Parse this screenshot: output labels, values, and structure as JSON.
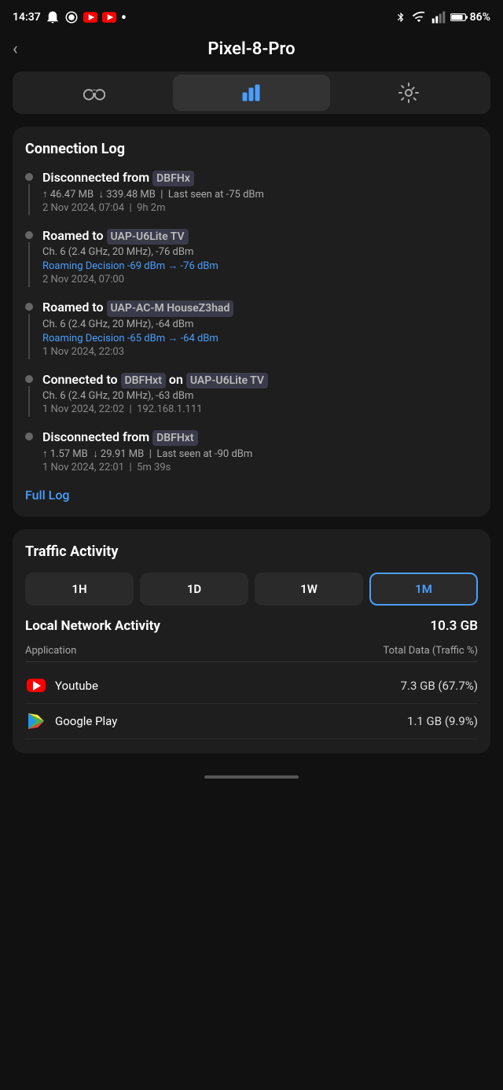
{
  "statusBar": {
    "time": "14:37",
    "battery": "86%"
  },
  "header": {
    "backLabel": "<",
    "title": "Pixel-8-Pro"
  },
  "tabs": [
    {
      "id": "binoculars",
      "icon": "binoculars",
      "active": false
    },
    {
      "id": "chart",
      "icon": "chart",
      "active": true
    },
    {
      "id": "settings",
      "icon": "settings",
      "active": false
    }
  ],
  "connectionLog": {
    "title": "Connection Log",
    "items": [
      {
        "type": "Disconnected from",
        "ssid": "DBFHx",
        "upload": "↑ 46.47 MB",
        "download": "↓ 339.48 MB",
        "lastSeen": "Last seen at -75 dBm",
        "date": "2 Nov 2024, 07:04",
        "duration": "9h 2m",
        "hasLine": true
      },
      {
        "type": "Roamed to",
        "ssid": "UAP-U6Lite TV",
        "channel": "Ch. 6 (2.4 GHz, 20 MHz), -76 dBm",
        "roaming": "Roaming Decision -69 dBm → -76 dBm",
        "date": "2 Nov 2024, 07:00",
        "hasLine": true
      },
      {
        "type": "Roamed to",
        "ssid": "UAP-AC-M HouseZ3had",
        "channel": "Ch. 6 (2.4 GHz, 20 MHz), -64 dBm",
        "roaming": "Roaming Decision -65 dBm → -64 dBm",
        "date": "1 Nov 2024, 22:03",
        "hasLine": true
      },
      {
        "type": "Connected to",
        "ssid": "DBFHxt",
        "on": "UAP-U6Lite TV",
        "channel": "Ch. 6 (2.4 GHz, 20 MHz), -63 dBm",
        "date": "1 Nov 2024, 22:02",
        "ip": "192.168.1.111",
        "hasLine": true
      },
      {
        "type": "Disconnected from",
        "ssid": "DBFHxt",
        "upload": "↑ 1.57 MB",
        "download": "↓ 29.91 MB",
        "lastSeen": "Last seen at -90 dBm",
        "date": "1 Nov 2024, 22:01",
        "duration": "5m 39s",
        "hasLine": false
      }
    ],
    "fullLog": "Full Log"
  },
  "trafficActivity": {
    "title": "Traffic Activity",
    "timeFilters": [
      "1H",
      "1D",
      "1W",
      "1M"
    ],
    "activeFilter": "1M",
    "localNetworkLabel": "Local Network Activity",
    "localNetworkValue": "10.3 GB",
    "colApplication": "Application",
    "colData": "Total Data (Traffic %)",
    "apps": [
      {
        "name": "Youtube",
        "data": "7.3 GB (67.7%)",
        "icon": "youtube"
      },
      {
        "name": "Google Play",
        "data": "1.1 GB (9.9%)",
        "icon": "googleplay"
      }
    ]
  }
}
